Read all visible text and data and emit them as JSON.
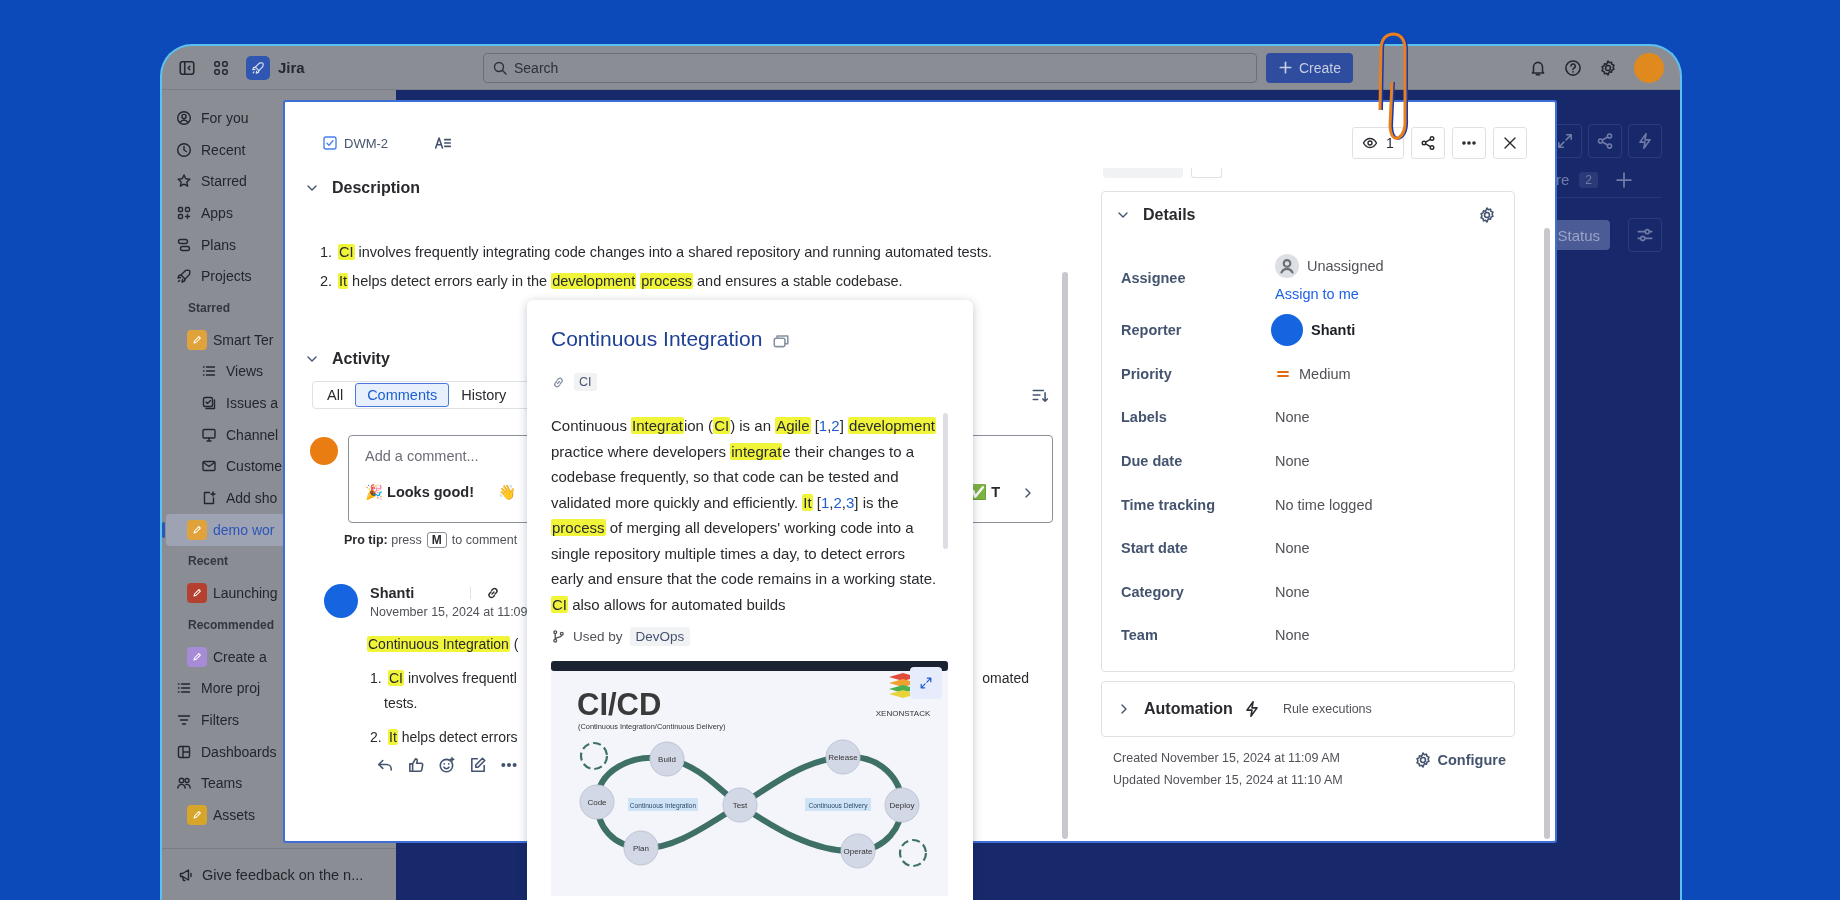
{
  "topbar": {
    "product": "Jira",
    "search": {
      "placeholder": "Search"
    },
    "create_button": "Create"
  },
  "sidebar": {
    "items": [
      {
        "kind": "item",
        "label": "For you",
        "selected": false
      },
      {
        "kind": "item",
        "label": "Recent",
        "selected": false
      },
      {
        "kind": "item",
        "label": "Starred",
        "selected": false
      },
      {
        "kind": "item",
        "label": "Apps",
        "selected": false
      },
      {
        "kind": "item",
        "label": "Plans",
        "selected": false
      },
      {
        "kind": "item",
        "label": "Projects",
        "selected": false
      },
      {
        "kind": "section",
        "label": "Starred"
      },
      {
        "kind": "project",
        "label": "Smart Ter",
        "color": "#e0a23a",
        "selected": false
      },
      {
        "kind": "subitem",
        "label": "Views",
        "selected": false
      },
      {
        "kind": "subitem",
        "label": "Issues a",
        "selected": false
      },
      {
        "kind": "subitem",
        "label": "Channel",
        "selected": false
      },
      {
        "kind": "subitem",
        "label": "Custome",
        "selected": false
      },
      {
        "kind": "subitem",
        "label": "Add sho",
        "selected": false
      },
      {
        "kind": "project",
        "label": "demo wor",
        "color": "#e0a23a",
        "selected": true
      },
      {
        "kind": "section",
        "label": "Recent"
      },
      {
        "kind": "project",
        "label": "Launching",
        "color": "#b5402f",
        "selected": false
      },
      {
        "kind": "section",
        "label": "Recommended"
      },
      {
        "kind": "project",
        "label": "Create a",
        "color": "#a88bd6",
        "selected": false
      },
      {
        "kind": "item",
        "label": "More proj",
        "selected": false
      },
      {
        "kind": "item",
        "label": "Filters",
        "selected": false
      },
      {
        "kind": "item",
        "label": "Dashboards",
        "selected": false
      },
      {
        "kind": "item",
        "label": "Teams",
        "selected": false
      },
      {
        "kind": "project",
        "label": "Assets",
        "color": "#d6a52a",
        "selected": false
      }
    ],
    "feedback": "Give feedback on the n..."
  },
  "board": {
    "tab_fragment": "re",
    "tab_count": "2",
    "group_button": "Status"
  },
  "issue": {
    "key": "DWM-2",
    "watchers": "1",
    "description": {
      "heading": "Description",
      "expanded": true,
      "items": [
        {
          "number": "1.",
          "segments": [
            {
              "text": "CI",
              "kind": "highlight"
            },
            {
              "text": " involves frequently integrating code changes into a shared repository and running automated tests.",
              "kind": "plain"
            }
          ]
        },
        {
          "number": "2.",
          "segments": [
            {
              "text": "It",
              "kind": "highlight"
            },
            {
              "text": " helps detect errors early in the ",
              "kind": "plain"
            },
            {
              "text": "development ",
              "kind": "highlight"
            },
            {
              "text": "process",
              "kind": "highlight"
            },
            {
              "text": " and ensures a stable codebase.",
              "kind": "plain"
            }
          ]
        }
      ]
    },
    "activity": {
      "heading": "Activity",
      "expanded": true,
      "tabs": [
        {
          "label": "All",
          "selected": false
        },
        {
          "label": "Comments",
          "selected": true
        },
        {
          "label": "History",
          "selected": false
        }
      ],
      "composer": {
        "placeholder": "Add a comment...",
        "quick_replies": [
          "🎉 Looks good!",
          "👋",
          "✅ T"
        ]
      },
      "pro_tip": {
        "text": "**Pro tip:** press",
        "key": "M",
        "after": "to comment"
      },
      "comments": [
        {
          "author": "Shanti",
          "date": "November 15, 2024 at 11:09",
          "lead": [
            {
              "text": "Continuous Integration",
              "kind": "highlight"
            },
            {
              "text": " (",
              "kind": "plain"
            }
          ],
          "items": [
            {
              "number": "1.",
              "segments": [
                {
                  "text": "CI",
                  "kind": "highlight"
                },
                {
                  "text": " involves frequentl",
                  "kind": "plain"
                }
              ],
              "right": "omated",
              "continuation": "tests."
            },
            {
              "number": "2.",
              "segments": [
                {
                  "text": "It",
                  "kind": "highlight"
                },
                {
                  "text": " helps detect errors",
                  "kind": "plain"
                }
              ]
            }
          ]
        }
      ]
    },
    "details": {
      "heading": "Details",
      "expanded": true,
      "fields": [
        {
          "label": "Assignee",
          "kind": "unassigned",
          "value": "Unassigned",
          "action": "Assign to me"
        },
        {
          "label": "Reporter",
          "kind": "user",
          "value": "Shanti"
        },
        {
          "label": "Priority",
          "kind": "priority",
          "value": "Medium"
        },
        {
          "label": "Labels",
          "kind": "text",
          "value": "None"
        },
        {
          "label": "Due date",
          "kind": "text",
          "value": "None"
        },
        {
          "label": "Time tracking",
          "kind": "text",
          "value": "No time logged"
        },
        {
          "label": "Start date",
          "kind": "text",
          "value": "None"
        },
        {
          "label": "Category",
          "kind": "text",
          "value": "None"
        },
        {
          "label": "Team",
          "kind": "text",
          "value": "None"
        }
      ]
    },
    "automation": {
      "heading": "Automation",
      "expanded": false,
      "caption": "Rule executions"
    },
    "created": "Created November 15, 2024 at 11:09 AM",
    "updated": "Updated November 15, 2024 at 11:10 AM",
    "configure_button": "Configure"
  },
  "popup": {
    "title": "Continuous Integration",
    "alias": "CI",
    "body": [
      {
        "text": "Continuous ",
        "kind": "plain"
      },
      {
        "text": "Integrat",
        "kind": "highlight"
      },
      {
        "text": "ion (",
        "kind": "plain"
      },
      {
        "text": "CI",
        "kind": "highlight"
      },
      {
        "text": ") is an ",
        "kind": "plain"
      },
      {
        "text": "Agile",
        "kind": "highlight"
      },
      {
        "text": " [",
        "kind": "plain"
      },
      {
        "text": "1",
        "kind": "link"
      },
      {
        "text": ",",
        "kind": "plain"
      },
      {
        "text": "2",
        "kind": "link"
      },
      {
        "text": "] ",
        "kind": "plain"
      },
      {
        "text": "development",
        "kind": "highlight"
      },
      {
        "text": " practice where developers ",
        "kind": "plain"
      },
      {
        "text": "integrat",
        "kind": "highlight"
      },
      {
        "text": "e their changes to a codebase frequently, so that code can be tested and validated more quickly and efficiently. ",
        "kind": "plain"
      },
      {
        "text": "It",
        "kind": "highlight"
      },
      {
        "text": " [",
        "kind": "plain"
      },
      {
        "text": "1",
        "kind": "link"
      },
      {
        "text": ",",
        "kind": "plain"
      },
      {
        "text": "2",
        "kind": "link"
      },
      {
        "text": ",",
        "kind": "plain"
      },
      {
        "text": "3",
        "kind": "link"
      },
      {
        "text": "] is the ",
        "kind": "plain"
      },
      {
        "text": "process",
        "kind": "highlight"
      },
      {
        "text": " of merging all developers' working code into a single repository multiple times a day, to detect errors early and ensure that the code remains in a working state. ",
        "kind": "plain"
      },
      {
        "text": "CI",
        "kind": "highlight"
      },
      {
        "text": " also allows for automated builds",
        "kind": "plain"
      }
    ],
    "used_by_label": "Used by",
    "used_by": "DevOps",
    "diagram": {
      "title": "CI/CD",
      "subtitle": "(Continuous Integration/Continuous Delivery)",
      "brand": "XENONSTACK",
      "stages": [
        "Code",
        "Build",
        "Plan",
        "Test",
        "Release",
        "Deploy",
        "Operate"
      ],
      "phases": [
        "Continuous Integration",
        "Continuous Delivery"
      ]
    }
  }
}
